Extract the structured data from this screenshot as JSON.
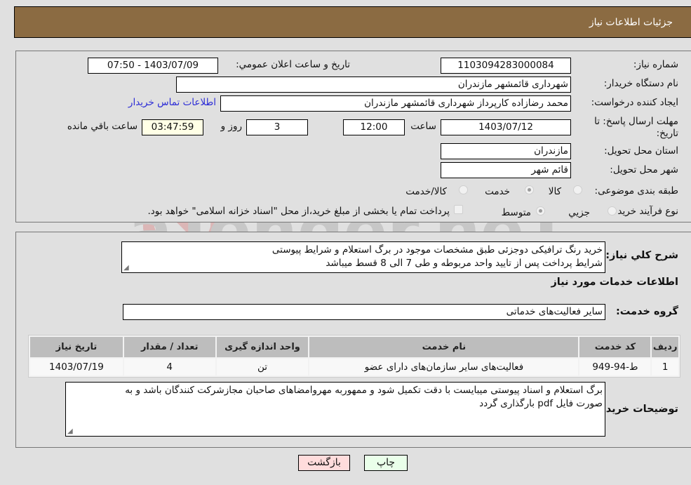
{
  "header": {
    "title": "جزئیات اطلاعات نیاز"
  },
  "form": {
    "need_number": {
      "label": "شماره نیاز:",
      "value": "1103094283000084"
    },
    "announce_datetime": {
      "label": "تاریخ و ساعت اعلان عمومي:",
      "value": "1403/07/09 - 07:50"
    },
    "buyer_org": {
      "label": "نام دستگاه خريدار:",
      "value": "شهرداری قائمشهر مازندران"
    },
    "creator": {
      "label": "ایجاد کننده درخواست:",
      "value": "محمد رضازاده کارپرداز شهرداری قائمشهر مازندران"
    },
    "buyer_contact_link": "اطلاعات تماس خريدار",
    "deadline": {
      "label_line1": "مهلت ارسال پاسخ: تا",
      "label_line2": "تاریخ:",
      "date": "1403/07/12",
      "time_label": "ساعت",
      "time": "12:00",
      "days": "3",
      "days_label": "روز و",
      "remaining": "03:47:59",
      "remaining_label": "ساعت باقي مانده"
    },
    "province": {
      "label": "استان محل تحویل:",
      "value": "مازندران"
    },
    "city": {
      "label": "شهر محل تحویل:",
      "value": "قائم شهر"
    },
    "category": {
      "label": "طبقه بندی موضوعی:",
      "options": [
        {
          "label": "کالا",
          "selected": false
        },
        {
          "label": "خدمت",
          "selected": true
        },
        {
          "label": "کالا/خدمت",
          "selected": false
        }
      ]
    },
    "process": {
      "label": "نوع فرآیند خرید :",
      "options": [
        {
          "label": "جزيي",
          "selected": false
        },
        {
          "label": "متوسط",
          "selected": true
        }
      ],
      "treasury_checkbox": {
        "checked": false,
        "label": "پرداخت تمام یا بخشی از مبلغ خرید،از محل \"اسناد خزانه اسلامی\" خواهد بود."
      }
    }
  },
  "description": {
    "label": "شرح کلي نياز:",
    "lines": [
      "خرید رنگ ترافیکی دوجزئی طبق مشخصات موجود در برگ استعلام و شرایط پیوستی",
      "شرایط پرداخت پس از تایید واحد مربوطه و طی 7 الی 8 قسط میباشد"
    ]
  },
  "services": {
    "section_title": "اطلاعات خدمات مورد نياز",
    "group_label": "گروه خدمت:",
    "group_value": "سایر فعالیت‌های خدماتی",
    "columns": [
      "رديف",
      "کد خدمت",
      "نام خدمت",
      "واحد اندازه گيری",
      "تعداد / مقدار",
      "تاريخ نياز"
    ],
    "rows": [
      [
        "1",
        "ط-94-949",
        "فعالیت‌های سایر سازمان‌های دارای عضو",
        "تن",
        "4",
        "1403/07/19"
      ]
    ]
  },
  "buyer_notes": {
    "label": "توضیحات خريدار:",
    "lines": [
      "برگ استعلام و اسناد پیوستی میبایست با دقت تکمیل شود و ممهوربه مهروامضاهای صاحبان مجازشرکت کنندگان باشد و به",
      "صورت فایل pdf بارگذاری گردد"
    ]
  },
  "buttons": {
    "print": "چاپ",
    "back": "بازگشت"
  },
  "watermark": {
    "text": "AriaTender.neT"
  }
}
